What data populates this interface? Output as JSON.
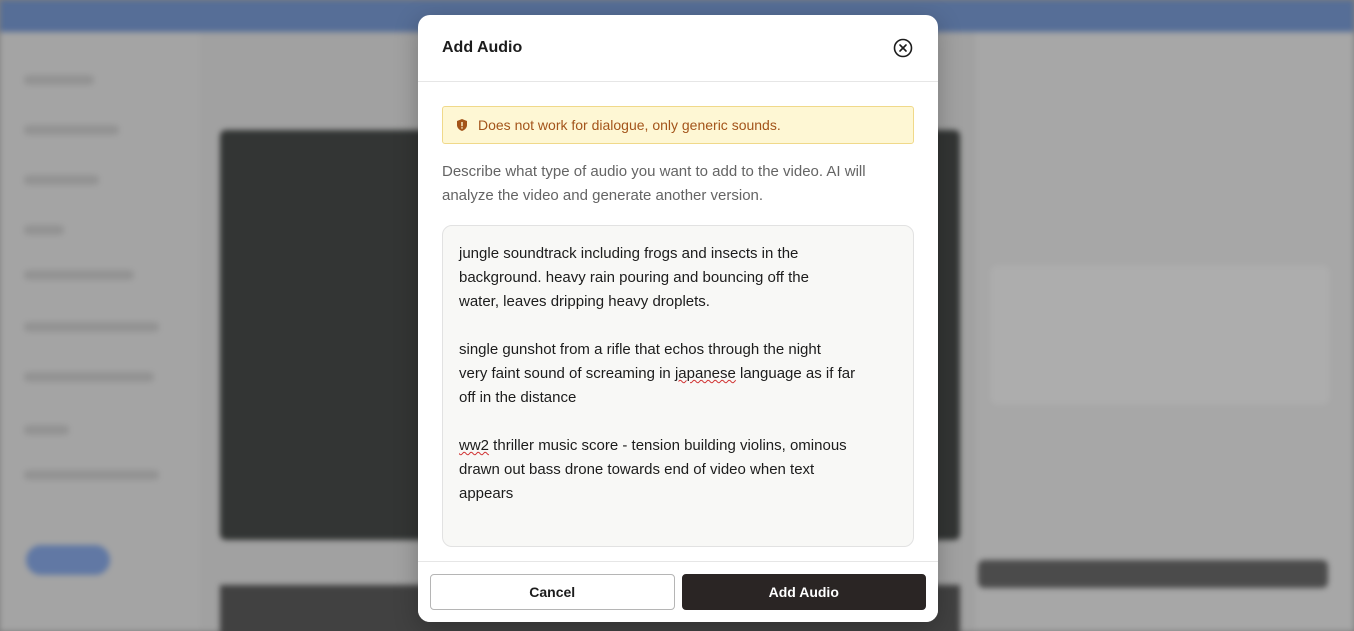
{
  "modal": {
    "title": "Add Audio",
    "close_icon": "close-circle-icon",
    "warning": {
      "icon": "shield-alert-icon",
      "text": "Does not work for dialogue, only generic sounds.",
      "color": "#a3541a",
      "background": "#fef7d4"
    },
    "description": "Describe what type of audio you want to add to the video. AI will analyze the video and generate another version.",
    "prompt": {
      "p1_line1": "jungle soundtrack including frogs and insects in the",
      "p1_line2": "background. heavy rain pouring and bouncing off the",
      "p1_line3": "water, leaves dripping heavy droplets.",
      "p2_line1": "single gunshot from a rifle that echos through the night",
      "p2_before": "very faint sound of screaming in ",
      "p2_typo": "japanese",
      "p2_after": " language as if far",
      "p2_line3": "off in the distance",
      "p3_typo": "ww2",
      "p3_rest": " thriller music score - tension building violins, ominous",
      "p3_line2": "drawn out bass drone towards end of video when text",
      "p3_line3": "appears"
    },
    "buttons": {
      "cancel": "Cancel",
      "submit": "Add Audio"
    }
  }
}
